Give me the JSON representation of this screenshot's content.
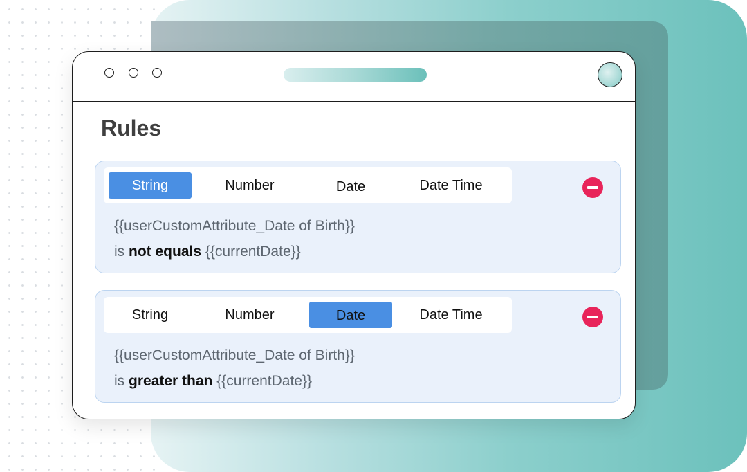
{
  "app": {
    "title": "Rules"
  },
  "colors": {
    "accent": "#4a8fe3",
    "remove": "#e8245a",
    "card_bg": "#eaf1fb",
    "teal": "#6cc1bc"
  },
  "rules": [
    {
      "tabs": [
        "String",
        "Number",
        "Date",
        "Date Time"
      ],
      "active_tab": "String",
      "attribute": "{{userCustomAttribute_Date of Birth}}",
      "is_label": "is",
      "operator": "not equals",
      "value": "{{currentDate}}",
      "remove_icon": "minus-circle-icon"
    },
    {
      "tabs": [
        "String",
        "Number",
        "Date",
        "Date Time"
      ],
      "active_tab": "Date",
      "attribute": "{{userCustomAttribute_Date of Birth}}",
      "is_label": "is",
      "operator": "greater than",
      "value": "{{currentDate}}",
      "remove_icon": "minus-circle-icon"
    }
  ]
}
